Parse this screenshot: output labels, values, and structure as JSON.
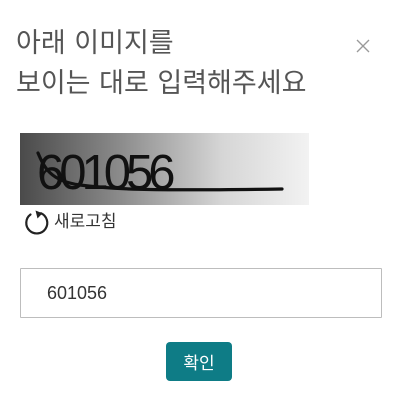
{
  "dialog": {
    "title_line1": "아래 이미지를",
    "title_line2": "보이는 대로 입력해주세요",
    "close_icon": "close-icon",
    "captcha": {
      "text": "601056",
      "icon": "captcha-image"
    },
    "refresh": {
      "icon": "refresh-icon",
      "label": "새로고침"
    },
    "answer_input": {
      "value": "601056",
      "placeholder": ""
    },
    "confirm_label": "확인",
    "colors": {
      "accent": "#0e7c86",
      "title": "#555555",
      "input_border": "#bdbdbd"
    }
  }
}
